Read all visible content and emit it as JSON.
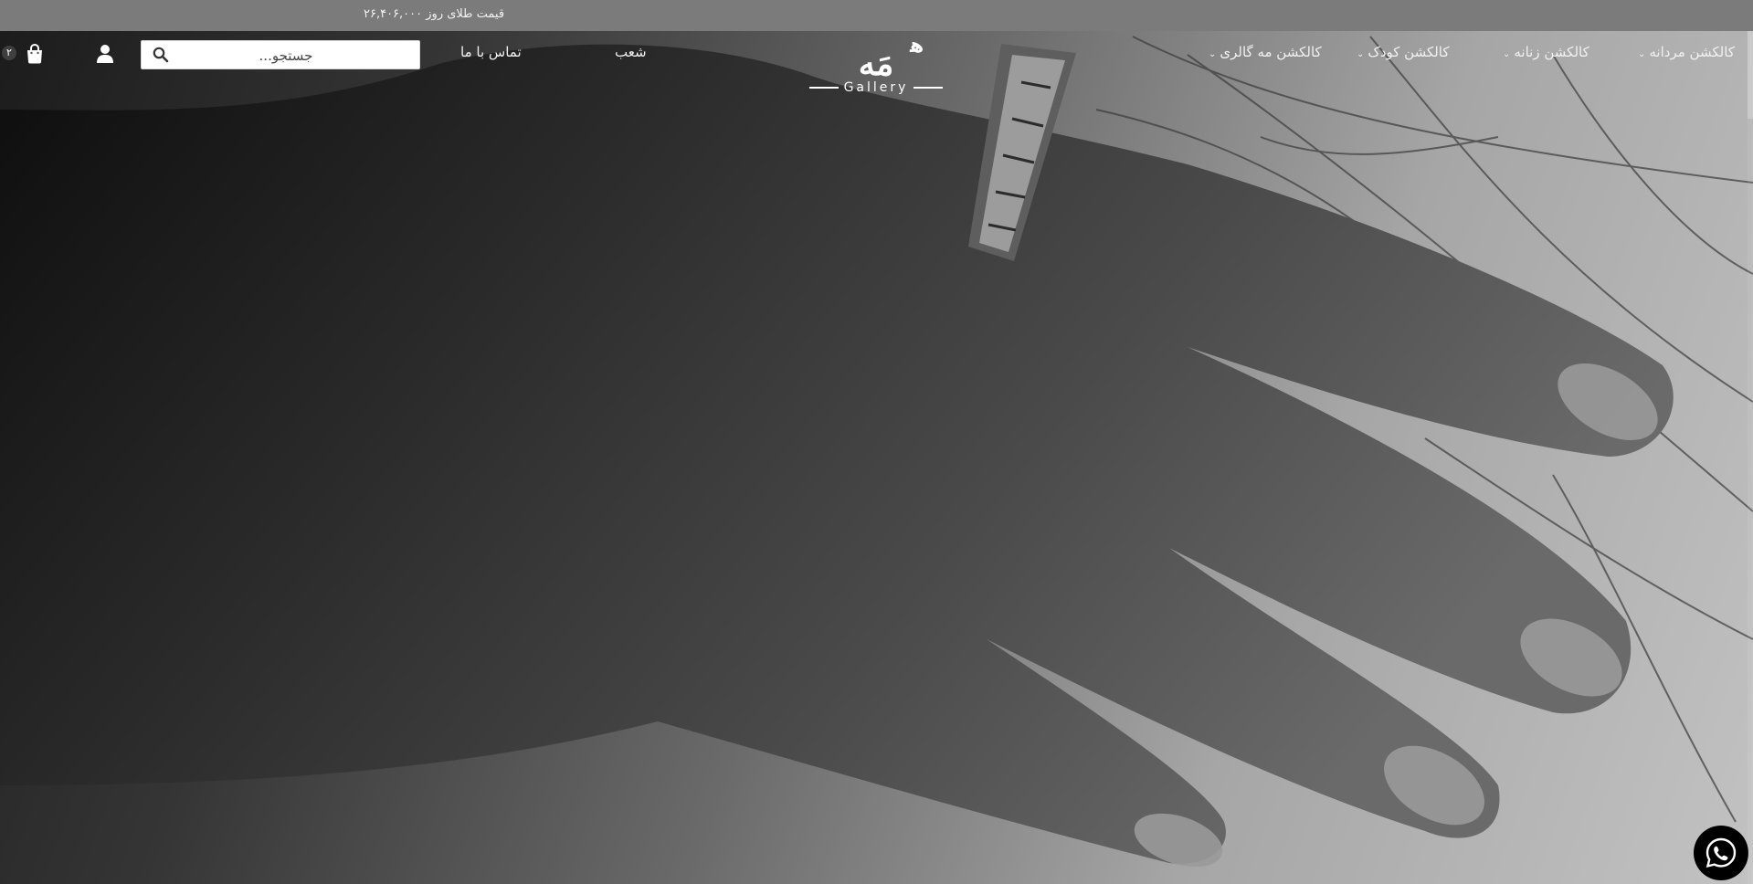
{
  "topbar": {
    "gold_price": "قیمت طلای روز ۲۶,۴۰۶,۰۰۰"
  },
  "nav": {
    "items": [
      {
        "label": "کالکشن مردانه",
        "has_dropdown": true
      },
      {
        "label": "کالکشن زنانه",
        "has_dropdown": true
      },
      {
        "label": "کالکشن کودک",
        "has_dropdown": true
      },
      {
        "label": "کالکشن مه گالری",
        "has_dropdown": true
      },
      {
        "label": "شعب",
        "has_dropdown": false
      },
      {
        "label": "تماس با ما",
        "has_dropdown": false
      }
    ],
    "chevron": "⌄"
  },
  "logo": {
    "mark": "مَه",
    "dots": "ﻫ",
    "wordmark": "Gallery"
  },
  "search": {
    "placeholder": "جستجو...",
    "value": ""
  },
  "cart": {
    "count": "۲"
  },
  "icons": {
    "search": "search-icon",
    "user": "user-icon",
    "cart": "shopping-bag-icon",
    "whatsapp": "whatsapp-icon"
  },
  "colors": {
    "topbar_bg": "#7b7b7b",
    "header_text": "#f1f1f1",
    "whatsapp_bg": "#000000"
  }
}
